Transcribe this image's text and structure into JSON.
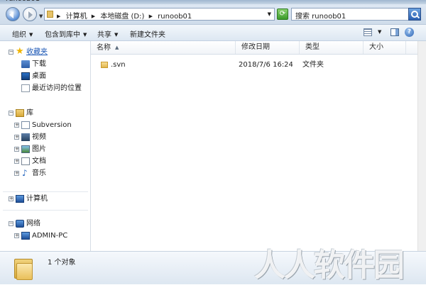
{
  "window": {
    "title": "runoob01"
  },
  "address": {
    "crumbs": [
      "计算机",
      "本地磁盘 (D:)",
      "runoob01"
    ]
  },
  "search": {
    "placeholder": "搜索 runoob01"
  },
  "toolbar": {
    "organize": "组织",
    "include_library": "包含到库中",
    "share": "共享",
    "new_folder": "新建文件夹"
  },
  "nav": {
    "favorites": "收藏夹",
    "downloads": "下载",
    "desktop": "桌面",
    "recent": "最近访问的位置",
    "libraries": "库",
    "subversion": "Subversion",
    "videos": "视频",
    "pictures": "图片",
    "documents": "文档",
    "music": "音乐",
    "computer": "计算机",
    "network": "网络",
    "admin_pc": "ADMIN-PC"
  },
  "columns": {
    "name": "名称",
    "modified": "修改日期",
    "type": "类型",
    "size": "大小"
  },
  "files": [
    {
      "name": ".svn",
      "modified": "2018/7/6 16:24",
      "type": "文件夹",
      "size": ""
    }
  ],
  "details": {
    "status": "1 个对象"
  },
  "watermark": "人人软件园",
  "icons": {
    "back": "back-arrow-icon",
    "forward": "forward-arrow-icon",
    "refresh": "refresh-icon",
    "search": "search-icon",
    "help": "help-icon"
  },
  "colors": {
    "link": "#1a56b5",
    "chrome": "#dde7f3"
  }
}
